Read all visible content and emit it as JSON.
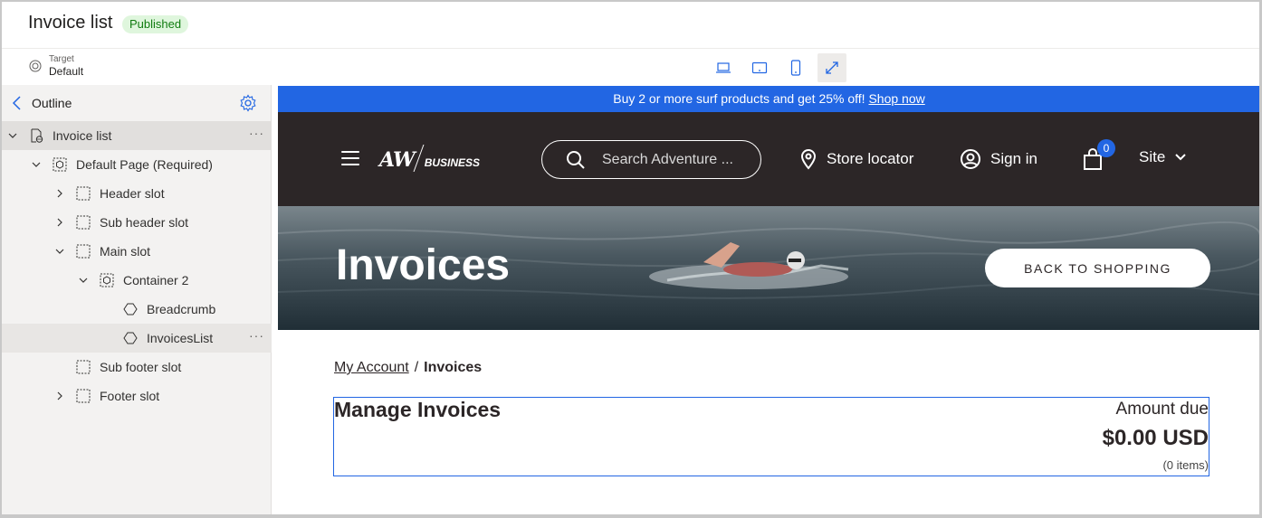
{
  "header": {
    "title": "Invoice list",
    "status_badge": "Published"
  },
  "toolbar": {
    "target_label": "Target",
    "target_value": "Default",
    "device_buttons": [
      "laptop-icon",
      "tablet-landscape-icon",
      "phone-icon",
      "expand-icon"
    ],
    "active_device": "expand-icon"
  },
  "outline": {
    "title": "Outline",
    "items": [
      {
        "label": "Invoice list",
        "level": 0,
        "expanded": true,
        "icon": "page-globe-icon",
        "selected": true
      },
      {
        "label": "Default Page (Required)",
        "level": 1,
        "expanded": true,
        "icon": "container-icon"
      },
      {
        "label": "Header slot",
        "level": 2,
        "expanded": false,
        "icon": "slot-icon"
      },
      {
        "label": "Sub header slot",
        "level": 2,
        "expanded": false,
        "icon": "slot-icon"
      },
      {
        "label": "Main slot",
        "level": 2,
        "expanded": true,
        "icon": "slot-icon"
      },
      {
        "label": "Container 2",
        "level": 3,
        "expanded": true,
        "icon": "container-icon"
      },
      {
        "label": "Breadcrumb",
        "level": 4,
        "icon": "module-icon"
      },
      {
        "label": "InvoicesList",
        "level": 4,
        "icon": "module-icon",
        "hovered": true
      },
      {
        "label": "Sub footer slot",
        "level": 2,
        "icon": "slot-icon"
      },
      {
        "label": "Footer slot",
        "level": 2,
        "expanded": false,
        "icon": "slot-icon"
      }
    ]
  },
  "preview": {
    "promo_text": "Buy 2 or more surf products and get 25% off!",
    "promo_link": "Shop now",
    "logo_main": "AW",
    "logo_sub": "BUSINESS",
    "search_placeholder": "Search Adventure ...",
    "store_locator": "Store locator",
    "sign_in": "Sign in",
    "cart_count": "0",
    "site": "Site",
    "hero_title": "Invoices",
    "back_button": "BACK TO SHOPPING",
    "breadcrumb_link": "My Account",
    "breadcrumb_sep": "/",
    "breadcrumb_current": "Invoices",
    "manage_title": "Manage Invoices",
    "amount_due_label": "Amount due",
    "amount_due_value": "$0.00 USD",
    "items_count": "(0 items)",
    "colors": {
      "promo_bg": "#2266e3",
      "header_bg": "#2c2627",
      "selection_border": "#2266e3",
      "badge_bg": "#dff6dd",
      "badge_text": "#107c10"
    }
  }
}
